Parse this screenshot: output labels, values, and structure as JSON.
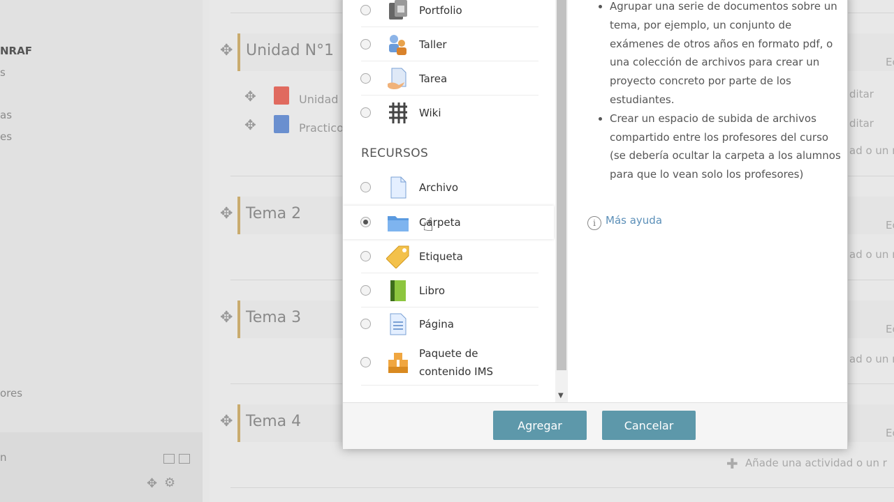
{
  "background": {
    "nav_fragments": [
      "NRAF",
      "s",
      "as",
      "es",
      "ores",
      "n"
    ],
    "sections": [
      {
        "title": "Unidad N°1"
      },
      {
        "title": "Tema 2"
      },
      {
        "title": "Tema 3"
      },
      {
        "title": "Tema 4"
      }
    ],
    "activities": [
      {
        "label": "Unidad"
      },
      {
        "label": "Practico"
      }
    ],
    "right_fragments": {
      "edit1": "ditar",
      "edit2": "ditar",
      "ec": "Ec",
      "add_partial": "ad o un r",
      "add_full": "Añade una actividad o un r"
    }
  },
  "modal": {
    "options_top": [
      {
        "label": "Portfolio",
        "icon": "portfolio-icon"
      },
      {
        "label": "Taller",
        "icon": "workshop-icon"
      },
      {
        "label": "Tarea",
        "icon": "assignment-icon"
      },
      {
        "label": "Wiki",
        "icon": "wiki-icon"
      }
    ],
    "resources_header": "RECURSOS",
    "resources": [
      {
        "label": "Archivo",
        "icon": "file-icon"
      },
      {
        "label": "Carpeta",
        "icon": "folder-icon",
        "selected": true
      },
      {
        "label": "Etiqueta",
        "icon": "label-tag-icon"
      },
      {
        "label": "Libro",
        "icon": "book-icon"
      },
      {
        "label": "Página",
        "icon": "page-icon"
      },
      {
        "label": "Paquete de contenido IMS",
        "icon": "ims-package-icon"
      }
    ],
    "help_items": [
      "Agrupar una serie de documentos sobre un tema, por ejemplo, un conjunto de exámenes de otros años en formato pdf, o una colección de archivos para crear un proyecto concreto por parte de los estudiantes.",
      "Crear un espacio de subida de archivos compartido entre los profesores del curso (se debería ocultar la carpeta a los alumnos para que lo vean solo los profesores)"
    ],
    "more_help": "Más ayuda",
    "add_button": "Agregar",
    "cancel_button": "Cancelar"
  }
}
